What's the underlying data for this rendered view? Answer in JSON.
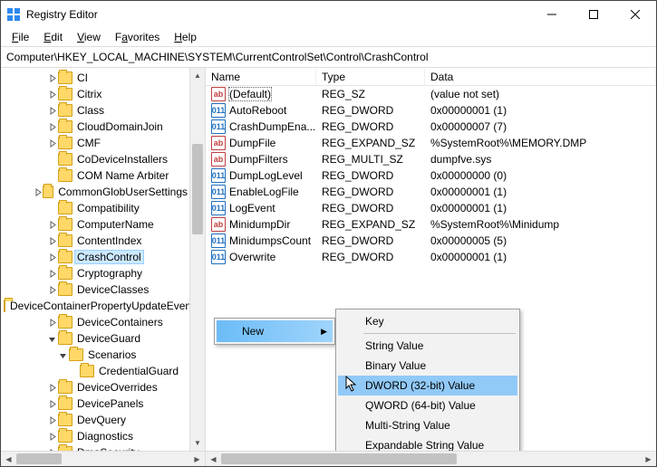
{
  "window": {
    "title": "Registry Editor"
  },
  "menu": {
    "file": "File",
    "edit": "Edit",
    "view": "View",
    "favorites": "Favorites",
    "help": "Help"
  },
  "address": "Computer\\HKEY_LOCAL_MACHINE\\SYSTEM\\CurrentControlSet\\Control\\CrashControl",
  "tree": {
    "items": [
      {
        "label": "CI",
        "depth": 4,
        "expandable": true
      },
      {
        "label": "Citrix",
        "depth": 4,
        "expandable": true
      },
      {
        "label": "Class",
        "depth": 4,
        "expandable": true
      },
      {
        "label": "CloudDomainJoin",
        "depth": 4,
        "expandable": true
      },
      {
        "label": "CMF",
        "depth": 4,
        "expandable": true
      },
      {
        "label": "CoDeviceInstallers",
        "depth": 4,
        "expandable": false
      },
      {
        "label": "COM Name Arbiter",
        "depth": 4,
        "expandable": false
      },
      {
        "label": "CommonGlobUserSettings",
        "depth": 4,
        "expandable": true
      },
      {
        "label": "Compatibility",
        "depth": 4,
        "expandable": false
      },
      {
        "label": "ComputerName",
        "depth": 4,
        "expandable": true
      },
      {
        "label": "ContentIndex",
        "depth": 4,
        "expandable": true
      },
      {
        "label": "CrashControl",
        "depth": 4,
        "expandable": true,
        "selected": true
      },
      {
        "label": "Cryptography",
        "depth": 4,
        "expandable": true
      },
      {
        "label": "DeviceClasses",
        "depth": 4,
        "expandable": true
      },
      {
        "label": "DeviceContainerPropertyUpdateEvents",
        "depth": 4,
        "expandable": false
      },
      {
        "label": "DeviceContainers",
        "depth": 4,
        "expandable": true
      },
      {
        "label": "DeviceGuard",
        "depth": 4,
        "expandable": true,
        "expanded": true
      },
      {
        "label": "Scenarios",
        "depth": 5,
        "expandable": true,
        "expanded": true
      },
      {
        "label": "CredentialGuard",
        "depth": 6,
        "expandable": false
      },
      {
        "label": "DeviceOverrides",
        "depth": 4,
        "expandable": true
      },
      {
        "label": "DevicePanels",
        "depth": 4,
        "expandable": true
      },
      {
        "label": "DevQuery",
        "depth": 4,
        "expandable": true
      },
      {
        "label": "Diagnostics",
        "depth": 4,
        "expandable": true
      },
      {
        "label": "DmaSecurity",
        "depth": 4,
        "expandable": true
      }
    ]
  },
  "list": {
    "headers": {
      "name": "Name",
      "type": "Type",
      "data": "Data"
    },
    "rows": [
      {
        "icon": "sz",
        "name": "(Default)",
        "type": "REG_SZ",
        "data": "(value not set)",
        "selected": true
      },
      {
        "icon": "bin",
        "name": "AutoReboot",
        "type": "REG_DWORD",
        "data": "0x00000001 (1)"
      },
      {
        "icon": "bin",
        "name": "CrashDumpEna...",
        "type": "REG_DWORD",
        "data": "0x00000007 (7)"
      },
      {
        "icon": "sz",
        "name": "DumpFile",
        "type": "REG_EXPAND_SZ",
        "data": "%SystemRoot%\\MEMORY.DMP"
      },
      {
        "icon": "sz",
        "name": "DumpFilters",
        "type": "REG_MULTI_SZ",
        "data": "dumpfve.sys"
      },
      {
        "icon": "bin",
        "name": "DumpLogLevel",
        "type": "REG_DWORD",
        "data": "0x00000000 (0)"
      },
      {
        "icon": "bin",
        "name": "EnableLogFile",
        "type": "REG_DWORD",
        "data": "0x00000001 (1)"
      },
      {
        "icon": "bin",
        "name": "LogEvent",
        "type": "REG_DWORD",
        "data": "0x00000001 (1)"
      },
      {
        "icon": "sz",
        "name": "MinidumpDir",
        "type": "REG_EXPAND_SZ",
        "data": "%SystemRoot%\\Minidump"
      },
      {
        "icon": "bin",
        "name": "MinidumpsCount",
        "type": "REG_DWORD",
        "data": "0x00000005 (5)"
      },
      {
        "icon": "bin",
        "name": "Overwrite",
        "type": "REG_DWORD",
        "data": "0x00000001 (1)"
      }
    ]
  },
  "context": {
    "new": "New",
    "sub": {
      "key": "Key",
      "string": "String Value",
      "binary": "Binary Value",
      "dword": "DWORD (32-bit) Value",
      "qword": "QWORD (64-bit) Value",
      "multi": "Multi-String Value",
      "expand": "Expandable String Value"
    }
  }
}
